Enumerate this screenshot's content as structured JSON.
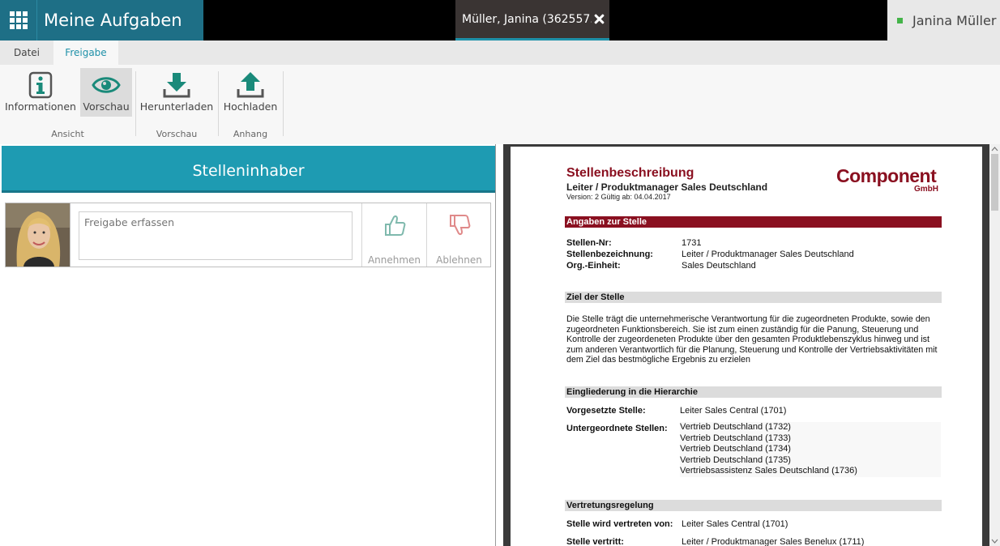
{
  "topbar": {
    "app_title": "Meine Aufgaben",
    "doc_tab_label": "Müller, Janina (362557...",
    "user_name": "Janina Müller",
    "status_color": "#44b449"
  },
  "ribbon": {
    "tabs": [
      "Datei",
      "Freigabe"
    ],
    "buttons": {
      "informationen": "Informationen",
      "vorschau": "Vorschau",
      "herunterladen": "Herunterladen",
      "hochladen": "Hochladen"
    },
    "groups": {
      "ansicht": "Ansicht",
      "vorschau": "Vorschau",
      "anhang": "Anhang"
    }
  },
  "left": {
    "header": "Stelleninhaber",
    "comment_placeholder": "Freigabe erfassen",
    "accept_label": "Annehmen",
    "reject_label": "Ablehnen"
  },
  "document": {
    "title": "Stellenbeschreibung",
    "subtitle": "Leiter / Produktmanager Sales Deutschland",
    "version": "Version: 2 Gültig ab: 04.04.2017",
    "logo_main": "Component",
    "logo_sub": "GmbH",
    "sec1": "Angaben zur Stelle",
    "stellen_nr_k": "Stellen-Nr:",
    "stellen_nr_v": "1731",
    "bez_k": "Stellenbezeichnung:",
    "bez_v": "Leiter / Produktmanager Sales Deutschland",
    "org_k": "Org.-Einheit:",
    "org_v": "Sales Deutschland",
    "sec2": "Ziel der Stelle",
    "ziel_text": "Die Stelle trägt die unternehmerische Verantwortung für die zugeordneten Produkte, sowie den zugeordneten Funktionsbereich. Sie ist zum einen zuständig für die Panung, Steuerung und Kontrolle der zugeordeneten Produkte über den gesamten Produktlebenszyklus hinweg und ist zum anderen Verantwortlich für die Planung, Steuerung und Kontrolle der Vertriebsaktivitäten mit dem Ziel das bestmögliche Ergebnis zu erzielen",
    "sec3": "Eingliederung in die Hierarchie",
    "vorg_k": "Vorgesetzte Stelle:",
    "vorg_v": "Leiter Sales Central (1701)",
    "unter_k": "Untergeordnete Stellen:",
    "unter_list": [
      "Vertrieb Deutschland (1732)",
      "Vertrieb Deutschland (1733)",
      "Vertrieb Deutschland (1734)",
      "Vertrieb Deutschland (1735)",
      "Vertriebsassistenz Sales Deutschland (1736)"
    ],
    "sec4": "Vertretungsregelung",
    "vertr_von_k": "Stelle wird vertreten von:",
    "vertr_von_v": "Leiter Sales Central (1701)",
    "vertritt_k": "Stelle vertritt:",
    "vertritt_v": "Leiter / Produktmanager Sales Benelux (1711)"
  }
}
